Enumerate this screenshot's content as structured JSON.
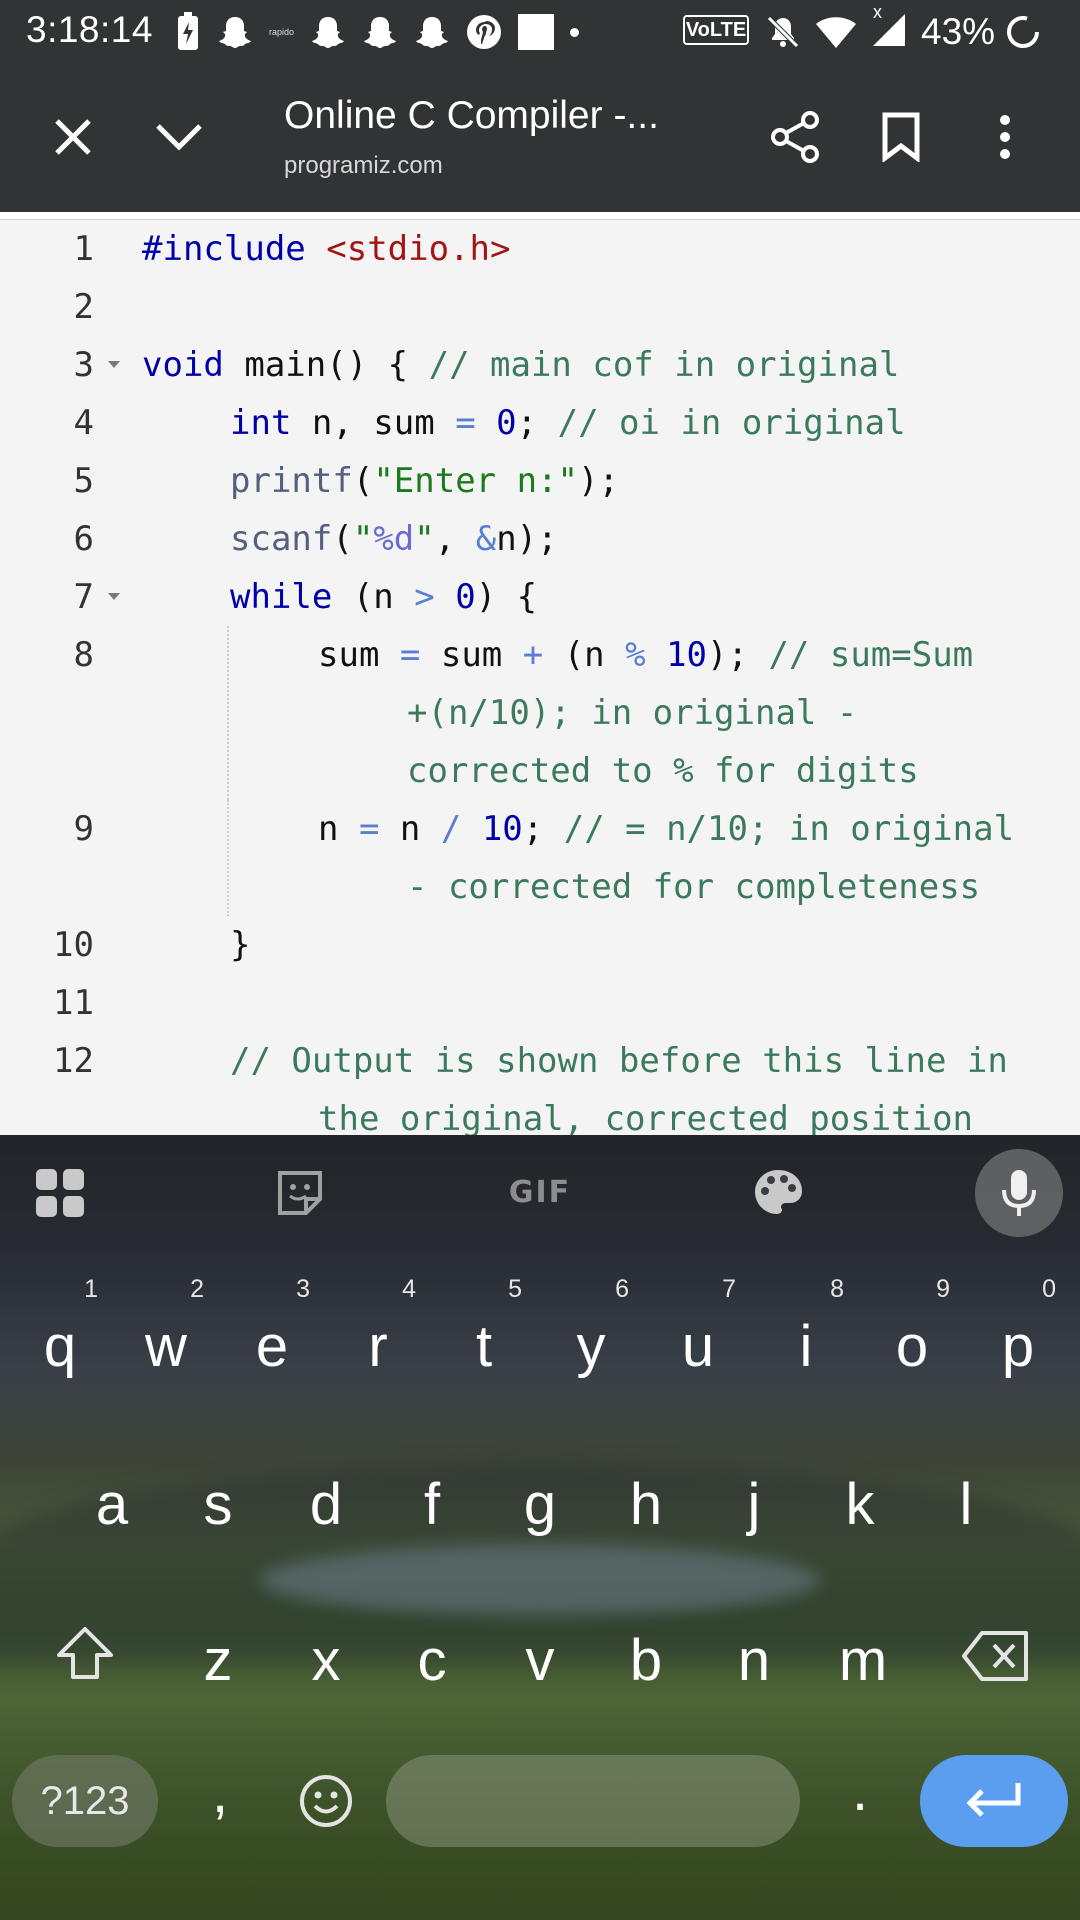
{
  "status_bar": {
    "time": "3:18:14",
    "rapido_label": "rapido",
    "volte_label": "VoLTE",
    "network_mark": "x",
    "battery": "43%"
  },
  "toolbar": {
    "title": "Online C Compiler -...",
    "domain": "programiz.com"
  },
  "editor": {
    "lines": [
      {
        "num": "1"
      },
      {
        "num": "2"
      },
      {
        "num": "3"
      },
      {
        "num": "4"
      },
      {
        "num": "5"
      },
      {
        "num": "6"
      },
      {
        "num": "7"
      },
      {
        "num": "8"
      },
      {
        "num": "9"
      },
      {
        "num": "10"
      },
      {
        "num": "11"
      },
      {
        "num": "12"
      }
    ],
    "code": {
      "l1_pre": "#include",
      "l1_inc": "<stdio.h>",
      "l3_kw": "void",
      "l3_code": " main() { ",
      "l3_com": "// main cof in original",
      "l4_kw": "int",
      "l4_a": " n, sum ",
      "l4_eq": "=",
      "l4_sp": " ",
      "l4_num": "0",
      "l4_semi": "; ",
      "l4_com": "// oi in original",
      "l5_fn": "printf",
      "l5_a": "(",
      "l5_str": "\"Enter n:\"",
      "l5_b": ");",
      "l6_fn": "scanf",
      "l6_a": "(",
      "l6_q1": "\"",
      "l6_fmt": "%d",
      "l6_q2": "\"",
      "l6_b": ", ",
      "l6_amp": "&",
      "l6_c": "n);",
      "l7_kw": "while",
      "l7_a": " (n ",
      "l7_op": ">",
      "l7_sp": " ",
      "l7_num": "0",
      "l7_b": ") {",
      "l8_a": "sum ",
      "l8_eq": "=",
      "l8_b": " sum ",
      "l8_plus": "+",
      "l8_c": " (n ",
      "l8_mod": "%",
      "l8_sp": " ",
      "l8_num": "10",
      "l8_d": "); ",
      "l8_com1": "// sum=Sum",
      "l8_com2": "+(n/10); in original -",
      "l8_com3": "corrected to % for digits",
      "l9_a": "n ",
      "l9_eq": "=",
      "l9_b": " n ",
      "l9_div": "/",
      "l9_sp": " ",
      "l9_num": "10",
      "l9_c": "; ",
      "l9_com1": "// = n/10; in original",
      "l9_com2": "- corrected for completeness",
      "l10": "}",
      "l12_com1": "// Output is shown before this line in",
      "l12_com2": "the original, corrected position"
    }
  },
  "keyboard": {
    "suggest_gif": "GIF",
    "row1": [
      {
        "ch": "q",
        "hint": "1"
      },
      {
        "ch": "w",
        "hint": "2"
      },
      {
        "ch": "e",
        "hint": "3"
      },
      {
        "ch": "r",
        "hint": "4"
      },
      {
        "ch": "t",
        "hint": "5"
      },
      {
        "ch": "y",
        "hint": "6"
      },
      {
        "ch": "u",
        "hint": "7"
      },
      {
        "ch": "i",
        "hint": "8"
      },
      {
        "ch": "o",
        "hint": "9"
      },
      {
        "ch": "p",
        "hint": "0"
      }
    ],
    "row2": [
      "a",
      "s",
      "d",
      "f",
      "g",
      "h",
      "j",
      "k",
      "l"
    ],
    "row3": [
      "z",
      "x",
      "c",
      "v",
      "b",
      "n",
      "m"
    ],
    "sym_label": "?123",
    "comma": ",",
    "period": "."
  },
  "colors": {
    "toolbar_bg": "#323335",
    "editor_bg": "#f4f4f4",
    "keyword": "#0000aa",
    "comment": "#3c7a5d",
    "string": "#1b7a1b",
    "include_path": "#a31515",
    "enter_key": "#5b9ef0"
  },
  "icons": {
    "toolbar": [
      "close-icon",
      "chevron-down-icon",
      "share-icon",
      "bookmark-icon",
      "more-vert-icon"
    ],
    "status": [
      "battery-charging-icon",
      "snapchat-icon",
      "pinterest-icon",
      "mute-icon",
      "wifi-icon",
      "signal-icon",
      "sync-icon"
    ],
    "keyboard": [
      "apps-grid-icon",
      "sticker-icon",
      "palette-icon",
      "mic-icon",
      "shift-icon",
      "backspace-icon",
      "emoji-icon",
      "enter-icon"
    ]
  }
}
